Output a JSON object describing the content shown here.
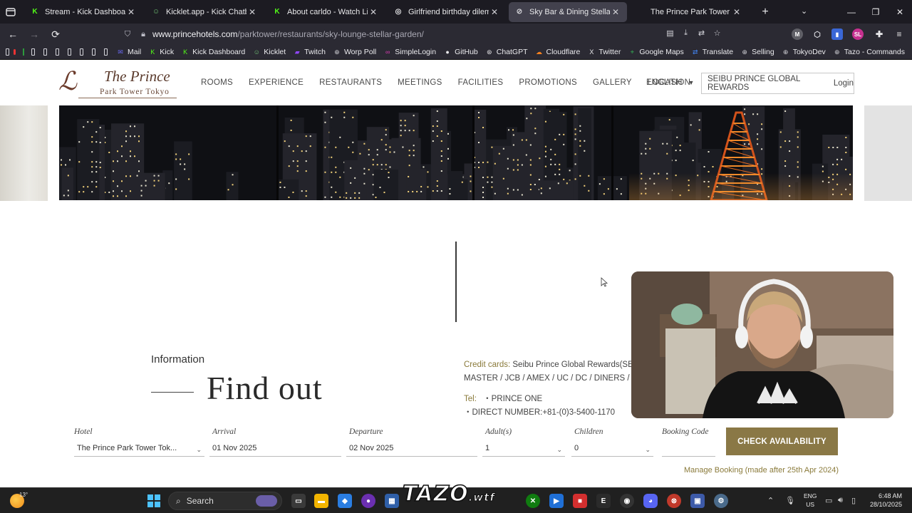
{
  "browser": {
    "tabs": [
      {
        "title": "Stream - Kick Dashboard",
        "favicon": "K",
        "favicon_color": "#53fc18",
        "active": false
      },
      {
        "title": "Kicklet.app - Kick Chatbot and C",
        "favicon": "☺",
        "favicon_color": "#6fbf73",
        "active": false
      },
      {
        "title": "About carldo - Watch Live o",
        "favicon": "K",
        "favicon_color": "#53fc18",
        "active": false
      },
      {
        "title": "Girlfriend birthday dilemma",
        "favicon": "◎",
        "favicon_color": "#e8e8ea",
        "active": false
      },
      {
        "title": "Sky Bar & Dining Stellar Garde",
        "favicon": "⊘",
        "favicon_color": "#cfcfd4",
        "active": true
      },
      {
        "title": "The Prince Park Tower Tokyo - P",
        "favicon": "",
        "favicon_color": "#2b2a33",
        "active": false
      }
    ],
    "url_host": "www.princehotels.com",
    "url_path": "/parktower/restaurants/sky-lounge-stellar-garden/",
    "bookmarks": [
      {
        "label": "Mail",
        "icon": "envelope-icon",
        "color": "#6a6af4"
      },
      {
        "label": "Kick",
        "icon": "K",
        "color": "#53fc18"
      },
      {
        "label": "Kick Dashboard",
        "icon": "K",
        "color": "#53fc18"
      },
      {
        "label": "Kicklet",
        "icon": "☺",
        "color": "#6fbf73"
      },
      {
        "label": "Twitch",
        "icon": "twitch-icon",
        "color": "#9147ff"
      },
      {
        "label": "Worp Poll",
        "icon": "globe-icon",
        "color": "#cfcfd4"
      },
      {
        "label": "SimpleLogin",
        "icon": "simplelogin-icon",
        "color": "#d63bb0"
      },
      {
        "label": "GitHub",
        "icon": "github-icon",
        "color": "#e8e8ea"
      },
      {
        "label": "ChatGPT",
        "icon": "chatgpt-icon",
        "color": "#e8e8ea"
      },
      {
        "label": "Cloudflare",
        "icon": "cloud-icon",
        "color": "#f48120"
      },
      {
        "label": "Twitter",
        "icon": "X",
        "color": "#e8e8ea"
      },
      {
        "label": "Google Maps",
        "icon": "map-pin-icon",
        "color": "#34a853"
      },
      {
        "label": "Translate",
        "icon": "translate-icon",
        "color": "#4285f4"
      },
      {
        "label": "Selling",
        "icon": "globe-icon",
        "color": "#cfcfd4"
      },
      {
        "label": "TokyoDev",
        "icon": "globe-icon",
        "color": "#cfcfd4"
      },
      {
        "label": "Tazo - Commands",
        "icon": "globe-icon",
        "color": "#cfcfd4"
      }
    ]
  },
  "site": {
    "logo_name": "The Prince",
    "logo_sub": "Park Tower Tokyo",
    "nav": [
      "ROOMS",
      "EXPERIENCE",
      "RESTAURANTS",
      "MEETINGS",
      "FACILITIES",
      "PROMOTIONS",
      "GALLERY",
      "LOCATION"
    ],
    "language": "ENGLISH",
    "rewards_label": "SEIBU PRINCE GLOBAL REWARDS",
    "login_label": "Login"
  },
  "info": {
    "section_label": "Information",
    "heading": "Find out",
    "credit_cards_label": "Credit cards:",
    "credit_cards_line1": "Seibu Prince Global Rewards(SEIBU",
    "credit_cards_line2": "MASTER / JCB / AMEX / UC / DC / DINERS / UFJ / S",
    "tel_label": "Tel:",
    "tel_line1": "・PRINCE ONE",
    "tel_line2": "・DIRECT NUMBER:+81-(0)3-5400-1170"
  },
  "booking": {
    "hotel_label": "Hotel",
    "hotel_value": "The Prince Park Tower Tok...",
    "arrival_label": "Arrival",
    "arrival_value": "01 Nov 2025",
    "departure_label": "Departure",
    "departure_value": "02 Nov 2025",
    "adults_label": "Adult(s)",
    "adults_value": "1",
    "children_label": "Children",
    "children_value": "0",
    "code_label": "Booking Code",
    "code_value": "",
    "check_label": "CHECK AVAILABILITY",
    "manage_label": "Manage Booking (made after 25th Apr 2024)"
  },
  "taskbar": {
    "temperature": "13°",
    "search_label": "Search",
    "lang_line1": "ENG",
    "lang_line2": "US",
    "time": "6:48 AM",
    "date": "28/10/2025",
    "overlay_logo": "TAZO",
    "overlay_logo_suffix": ".wtf"
  },
  "colors": {
    "accent_gold": "#8a7846",
    "brand_brown": "#6b3b2b"
  }
}
